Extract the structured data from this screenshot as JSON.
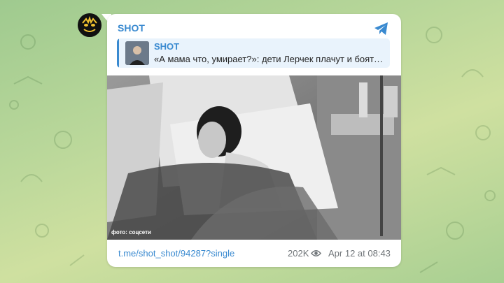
{
  "channel": {
    "name": "SHOT"
  },
  "reply": {
    "title": "SHOT",
    "text": "«А мама что, умирает?»: дети Лерчек плачут и боятс..."
  },
  "photo": {
    "caption": "фото: соцсети"
  },
  "footer": {
    "link": "t.me/shot_shot/94287?single",
    "views": "202K",
    "date": "Apr 12 at 08:43"
  },
  "colors": {
    "accent": "#3a8ad0",
    "card": "#ffffff",
    "reply_bg": "#e9f3fc"
  }
}
